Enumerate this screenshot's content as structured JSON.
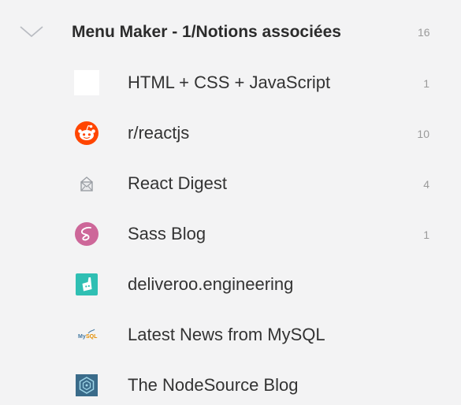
{
  "folder": {
    "title": "Menu Maker - 1/Notions associées",
    "count": "16",
    "expand_icon": "chevron-down-icon"
  },
  "feeds": [
    {
      "label": "HTML + CSS + JavaScript",
      "count": "1",
      "icon": "blank-favicon-icon"
    },
    {
      "label": "r/reactjs",
      "count": "10",
      "icon": "reddit-icon",
      "color": "#ff4500"
    },
    {
      "label": "React Digest",
      "count": "4",
      "icon": "envelope-icon"
    },
    {
      "label": "Sass Blog",
      "count": "1",
      "icon": "sass-icon",
      "color": "#cd6799"
    },
    {
      "label": "deliveroo.engineering",
      "count": "",
      "icon": "deliveroo-icon",
      "color": "#2fbfb3"
    },
    {
      "label": "Latest News from MySQL",
      "count": "",
      "icon": "mysql-icon"
    },
    {
      "label": "The NodeSource Blog",
      "count": "",
      "icon": "nodesource-icon",
      "color": "#3a6b8a"
    }
  ]
}
